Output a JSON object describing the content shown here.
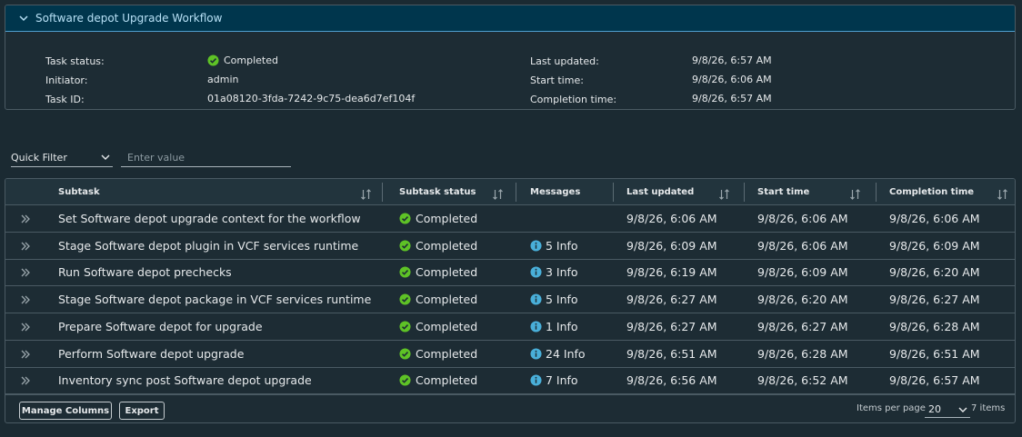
{
  "panel": {
    "title": "Software depot Upgrade Workflow",
    "left": [
      {
        "label": "Task status:",
        "value": "Completed",
        "status": "completed"
      },
      {
        "label": "Initiator:",
        "value": "admin"
      },
      {
        "label": "Task ID:",
        "value": "01a08120-3fda-7242-9c75-dea6d7ef104f"
      }
    ],
    "right": [
      {
        "label": "Last updated:",
        "value": "9/8/26, 6:57 AM"
      },
      {
        "label": "Start time:",
        "value": "9/8/26, 6:06 AM"
      },
      {
        "label": "Completion time:",
        "value": "9/8/26, 6:57 AM"
      }
    ]
  },
  "filter": {
    "select_label": "Quick Filter",
    "input_placeholder": "Enter value"
  },
  "table": {
    "columns": [
      "Subtask",
      "Subtask status",
      "Messages",
      "Last updated",
      "Start time",
      "Completion time"
    ],
    "rows": [
      {
        "subtask": "Set Software depot upgrade context for the workflow",
        "status": "Completed",
        "messages": "",
        "last_updated": "9/8/26, 6:06 AM",
        "start_time": "9/8/26, 6:06 AM",
        "completion_time": "9/8/26, 6:06 AM"
      },
      {
        "subtask": "Stage Software depot plugin in VCF services runtime",
        "status": "Completed",
        "messages": "5 Info",
        "last_updated": "9/8/26, 6:09 AM",
        "start_time": "9/8/26, 6:06 AM",
        "completion_time": "9/8/26, 6:09 AM"
      },
      {
        "subtask": "Run Software depot prechecks",
        "status": "Completed",
        "messages": "3 Info",
        "last_updated": "9/8/26, 6:19 AM",
        "start_time": "9/8/26, 6:09 AM",
        "completion_time": "9/8/26, 6:20 AM"
      },
      {
        "subtask": "Stage Software depot package in VCF services runtime",
        "status": "Completed",
        "messages": "5 Info",
        "last_updated": "9/8/26, 6:27 AM",
        "start_time": "9/8/26, 6:20 AM",
        "completion_time": "9/8/26, 6:27 AM"
      },
      {
        "subtask": "Prepare Software depot for upgrade",
        "status": "Completed",
        "messages": "1 Info",
        "last_updated": "9/8/26, 6:27 AM",
        "start_time": "9/8/26, 6:27 AM",
        "completion_time": "9/8/26, 6:28 AM"
      },
      {
        "subtask": "Perform Software depot upgrade",
        "status": "Completed",
        "messages": "24 Info",
        "last_updated": "9/8/26, 6:51 AM",
        "start_time": "9/8/26, 6:28 AM",
        "completion_time": "9/8/26, 6:51 AM"
      },
      {
        "subtask": "Inventory sync post Software depot upgrade",
        "status": "Completed",
        "messages": "7 Info",
        "last_updated": "9/8/26, 6:56 AM",
        "start_time": "9/8/26, 6:52 AM",
        "completion_time": "9/8/26, 6:57 AM"
      }
    ]
  },
  "footer": {
    "manage_columns": "Manage Columns",
    "export": "Export",
    "items_per_page_label": "Items per page",
    "items_per_page": "20",
    "item_count": "7 items"
  },
  "colors": {
    "success": "#5ec226",
    "info": "#49afd9",
    "header_bg": "#00364d"
  },
  "icons": {
    "status": "check-circle-icon",
    "messages": "info-circle-icon",
    "expand": "double-chevron-right-icon",
    "sort": "sort-arrows-icon",
    "collapse": "chevron-down-icon"
  }
}
